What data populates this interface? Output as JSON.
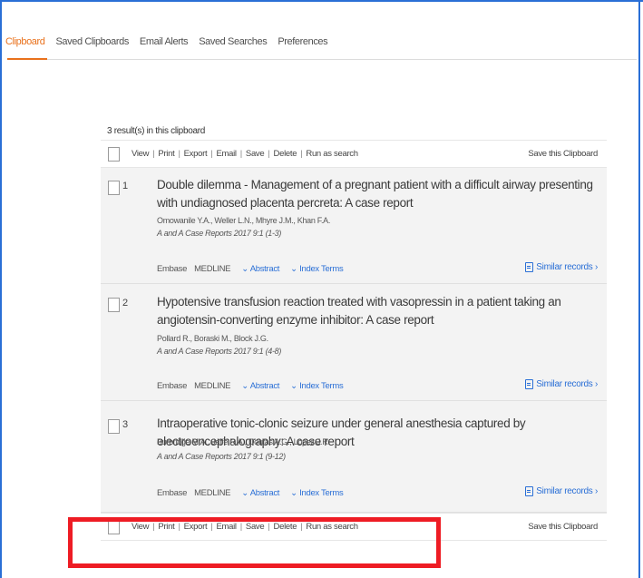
{
  "tabs": [
    {
      "label": "Clipboard",
      "active": true
    },
    {
      "label": "Saved Clipboards",
      "active": false
    },
    {
      "label": "Email Alerts",
      "active": false
    },
    {
      "label": "Saved Searches",
      "active": false
    },
    {
      "label": "Preferences",
      "active": false
    }
  ],
  "results_count": "3 result(s) in this clipboard",
  "toolbar": {
    "view": "View",
    "print": "Print",
    "export": "Export",
    "email": "Email",
    "save": "Save",
    "delete": "Delete",
    "run_as_search": "Run as search",
    "separator": "|",
    "save_clipboard": "Save this Clipboard"
  },
  "records": [
    {
      "number": "1",
      "title": "Double dilemma - Management of a pregnant patient with a difficult airway presenting with undiagnosed placenta percreta: A case report",
      "authors": "Omowanile Y.A., Weller L.N., Mhyre J.M., Khan F.A.",
      "source": "A and A Case Reports 2017 9:1 (1-3)",
      "databases": [
        "Embase",
        "MEDLINE"
      ],
      "abstract_link": "Abstract",
      "index_terms_link": "Index Terms",
      "similar_records": "Similar records"
    },
    {
      "number": "2",
      "title": "Hypotensive transfusion reaction treated with vasopressin in a patient taking an angiotensin-converting enzyme inhibitor: A case report",
      "authors": "Pollard R., Boraski M., Block J.G.",
      "source": "A and A Case Reports 2017 9:1 (4-8)",
      "databases": [
        "Embase",
        "MEDLINE"
      ],
      "abstract_link": "Abstract",
      "index_terms_link": "Index Terms",
      "similar_records": "Similar records"
    },
    {
      "number": "3",
      "title": "Intraoperative tonic-clonic seizure under general anesthesia captured by electroencephalography: A case report",
      "authors": "Burbridge M.A., Jaffe R.A., Doufas A.G., Lopez J.R.",
      "source": "A and A Case Reports 2017 9:1 (9-12)",
      "databases": [
        "Embase",
        "MEDLINE"
      ],
      "abstract_link": "Abstract",
      "index_terms_link": "Index Terms",
      "similar_records": "Similar records"
    }
  ],
  "colors": {
    "accent": "#e9711c",
    "link": "#2a6fd6",
    "highlight": "#ee1c24",
    "frame": "#2a6fd6"
  }
}
